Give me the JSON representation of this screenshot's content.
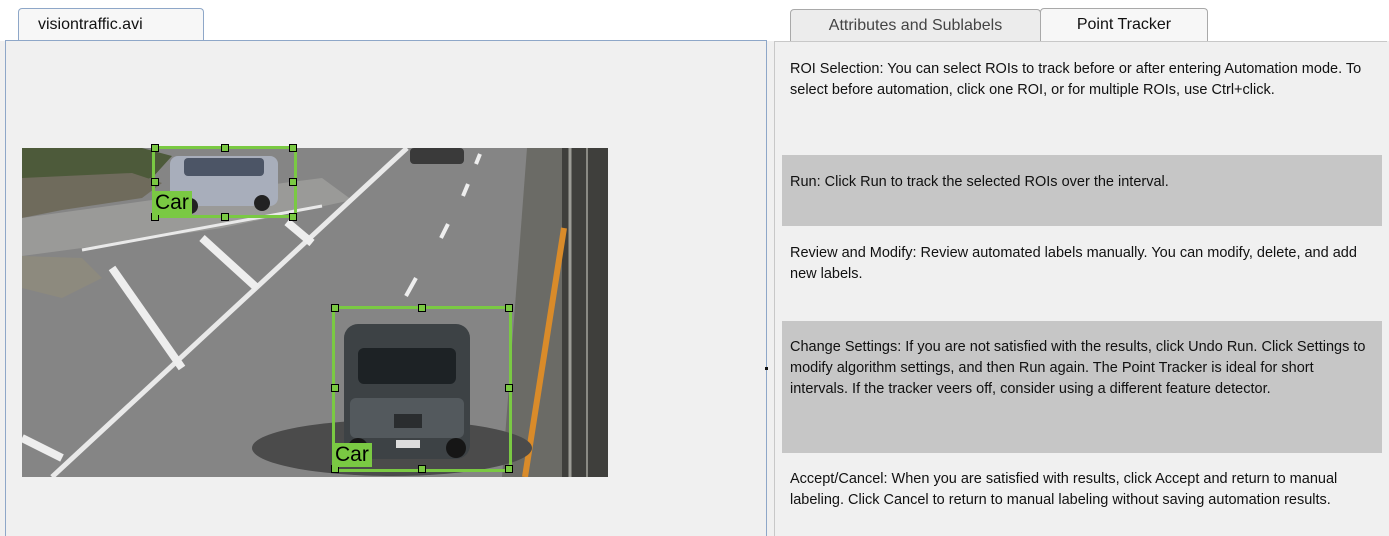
{
  "left_panel": {
    "tab_label": "visiontraffic.avi",
    "rois": [
      {
        "label": "Car"
      },
      {
        "label": "Car"
      }
    ]
  },
  "right_panel": {
    "tabs": [
      {
        "label": "Attributes and Sublabels",
        "active": false
      },
      {
        "label": "Point Tracker",
        "active": true
      }
    ],
    "steps": [
      {
        "text": "ROI Selection: You can select ROIs to track before or after entering Automation mode.  To select before automation, click one ROI, or for multiple ROIs, use Ctrl+click."
      },
      {
        "text": "Run: Click Run to track the selected ROIs over the interval."
      },
      {
        "text": "Review and Modify: Review automated labels manually. You can modify, delete, and add new labels."
      },
      {
        "text": "Change Settings: If you are not satisfied with the results, click Undo Run. Click Settings to modify algorithm settings, and then Run again. The Point Tracker is ideal for short intervals. If the tracker veers off, consider using a different feature detector."
      },
      {
        "text": "Accept/Cancel: When you are satisfied with results, click Accept and return to manual labeling. Click Cancel to return to manual labeling without saving automation results."
      }
    ]
  },
  "colors": {
    "roi_green": "#7ac943",
    "step_shade": "#c6c6c6",
    "tab_border": "#8ea7c8"
  }
}
